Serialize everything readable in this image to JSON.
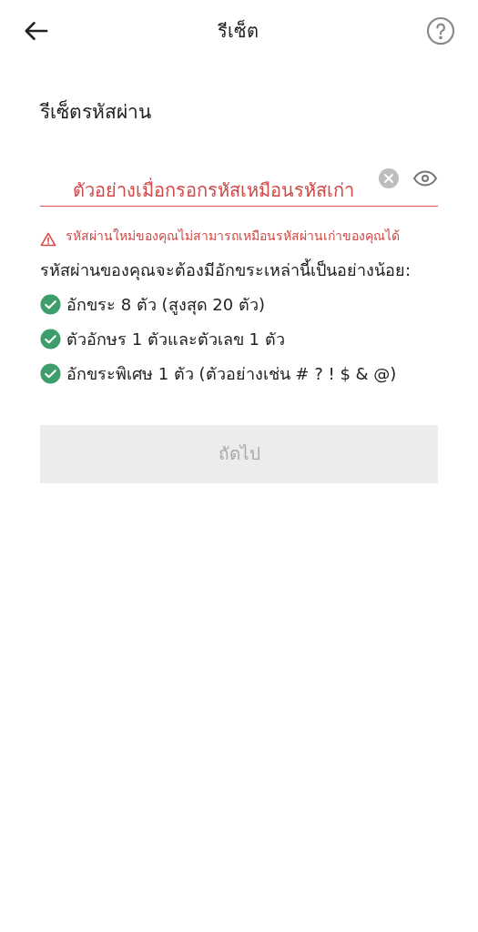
{
  "header": {
    "title": "รีเซ็ต"
  },
  "page_title": "รีเซ็ตรหัสผ่าน",
  "password_field": {
    "value": "ตัวอย่างเมื่อกรอกรหัสเหมือนรหัสเก่า",
    "error": true
  },
  "error_message": "รหัสผ่านใหม่ของคุณไม่สามารถเหมือนรหัสผ่านเก่าของคุณได้",
  "requirements_intro": "รหัสผ่านของคุณจะต้องมีอักขระเหล่านี้เป็นอย่างน้อย:",
  "requirements": [
    {
      "text": "อักขระ 8 ตัว (สูงสุด 20 ตัว)",
      "checked": true
    },
    {
      "text": "ตัวอักษร 1 ตัวและตัวเลข 1 ตัว",
      "checked": true
    },
    {
      "text": "อักขระพิเศษ 1 ตัว (ตัวอย่างเช่น # ? ! $ & @)",
      "checked": true
    }
  ],
  "next_button": {
    "label": "ถัดไป",
    "disabled": true
  }
}
